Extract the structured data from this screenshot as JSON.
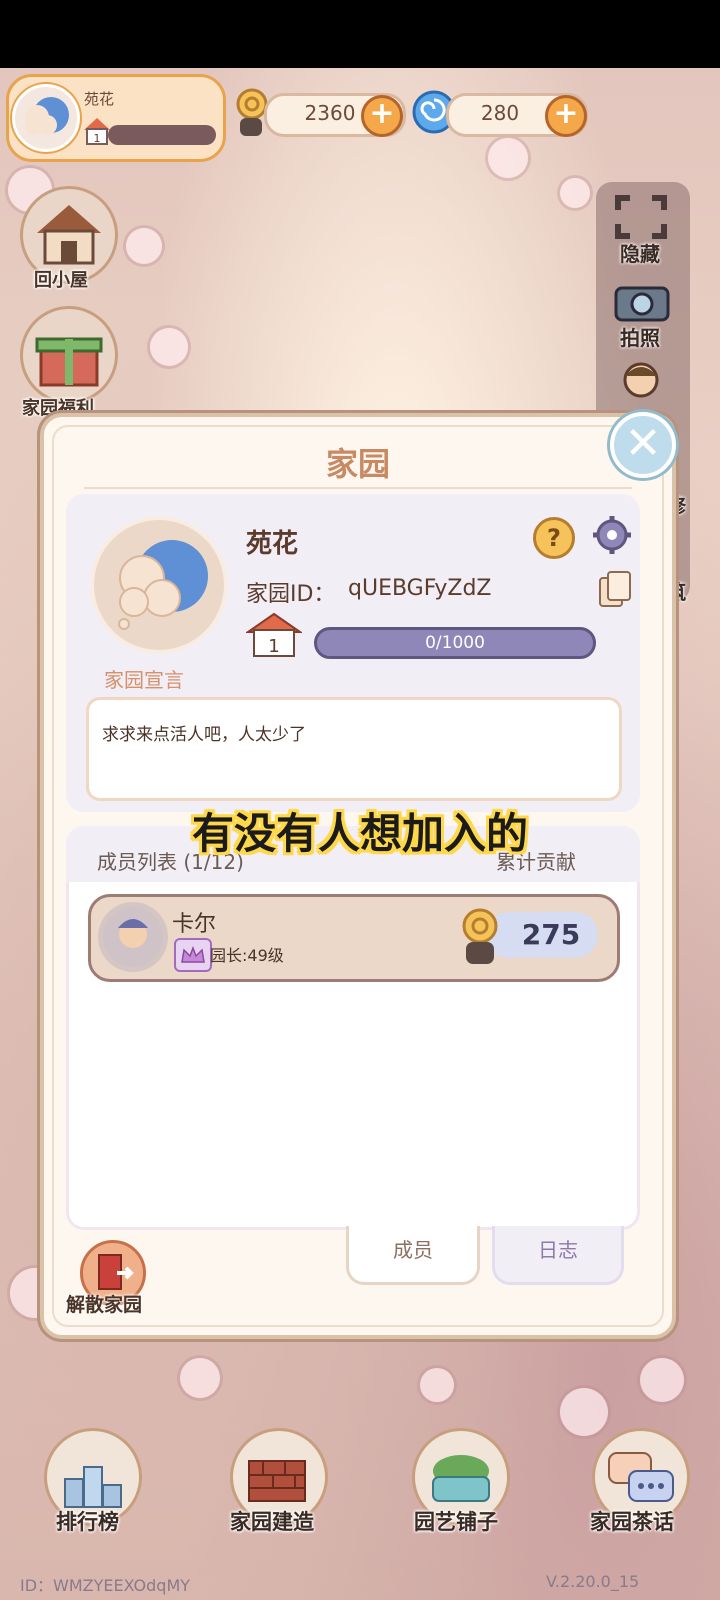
{
  "profile": {
    "name": "苑花",
    "level": "1"
  },
  "currency": {
    "coins": "2360",
    "gems": "280"
  },
  "left_menu": {
    "home": "回小屋",
    "welfare": "家园福利"
  },
  "right_menu": {
    "hide": "隐藏",
    "photo": "拍照",
    "repair": "修",
    "build": "筑"
  },
  "dialog": {
    "title": "家园",
    "garden_name": "苑花",
    "garden_id_label": "家园ID：",
    "garden_id": "qUEBGFyZdZ",
    "level": "1",
    "exp": "0/1000",
    "manifesto_label": "家园宣言",
    "manifesto": "求求来点活人吧，人太少了",
    "members_title": "成员列表 (1/12)",
    "contribution_title": "累计贡献",
    "members": [
      {
        "name": "卡尔",
        "role": "园长:49级",
        "contribution": "275"
      }
    ],
    "tabs": {
      "members": "成员",
      "log": "日志"
    },
    "disband": "解散家园",
    "close_icon": "✕"
  },
  "caption": "有没有人想加入的",
  "bottom_menu": {
    "ranking": "排行榜",
    "build": "家园建造",
    "shop": "园艺铺子",
    "chat": "家园茶话"
  },
  "footer": {
    "id": "ID：WMZYEEXOdqMY",
    "version": "V.2.20.0_15"
  },
  "colors": {
    "accent": "#c88a63",
    "dialog_bg": "#fdf7f0",
    "exp_bar": "#8f87b8"
  }
}
